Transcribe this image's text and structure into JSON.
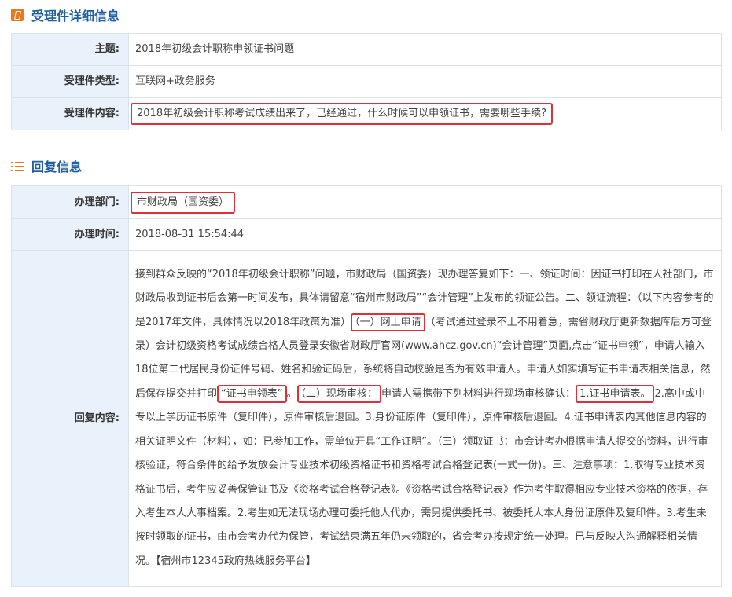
{
  "detail": {
    "title": "受理件详细信息",
    "rows": [
      {
        "label": "主题:",
        "value": "2018年初级会计职称申领证书问题"
      },
      {
        "label": "受理件类型:",
        "value": "互联网+政务服务"
      },
      {
        "label": "受理件内容:",
        "value": "2018年初级会计职称考试成绩出来了，已经通过，什么时候可以申领证书，需要哪些手续?"
      }
    ]
  },
  "reply": {
    "title": "回复信息",
    "dept_label": "办理部门:",
    "dept_value": "市财政局（国资委）",
    "time_label": "办理时间:",
    "time_value": "2018-08-31 15:54:44",
    "content_label": "回复内容:",
    "content_parts": {
      "p1": "接到群众反映的“2018年初级会计职称”问题，市财政局（国资委）现办理答复如下：一、领证时间：因证书打印在人社部门，市财政局收到证书后会第一时间发布，具体请留意“宿州市财政局”“会计管理”上发布的领证公告。二、领证流程：（以下内容参考的是2017年文件，具体情况以2018年政策为准）",
      "h1": "（一）网上申请",
      "p2": "（考试通过登录不上不用着急，需省财政厅更新数据库后方可登录）会计初级资格考试成绩合格人员登录安徽省财政厅官网(www.ahcz.gov.cn)“会计管理”页面,点击“证书申领”，申请人输入18位第二代居民身份证件号码、姓名和验证码后，系统将自动校验是否为有效申请人。申请人如实填写证书申请表相关信息，然后保存提交并打印",
      "h2": "“证书申领表”",
      "p3": "。",
      "h3": "（二）现场审核：",
      "p4": "申请人需携带下列材料进行现场审核确认：",
      "h4": "1.证书申请表。",
      "p5": "2.高中或中专以上学历证书原件（复印件），原件审核后退回。3.身份证原件（复印件），原件审核后退回。4.证书申请表内其他信息内容的相关证明文件（材料），如：已参加工作，需单位开具“工作证明”。（三）领取证书：市会计考办根据申请人提交的资料，进行审核验证，符合条件的给予发放会计专业技术初级资格证书和资格考试合格登记表(一式一份)。三、注意事项：1.取得专业技术资格证书后，考生应妥善保管证书及《资格考试合格登记表》。《资格考试合格登记表》作为考生取得相应专业技术资格的依据，存入考生本人人事档案。2.考生如无法现场办理可委托他人代办，需另提供委托书、被委托人本人身份证原件及复印件。3.考生未按时领取的证书，由市会考办代为保管，考试结束满五年仍未领取的，省会考办按规定统一处理。已与反映人沟通解释相关情况。【宿州市12345政府热线服务平台】"
    }
  },
  "colors": {
    "accent_title": "#1f5f9f",
    "icon_orange": "#e8791e",
    "label_bg": "#e9f1fb",
    "border": "#d9e3ee",
    "highlight_box": "#e02e3c"
  }
}
